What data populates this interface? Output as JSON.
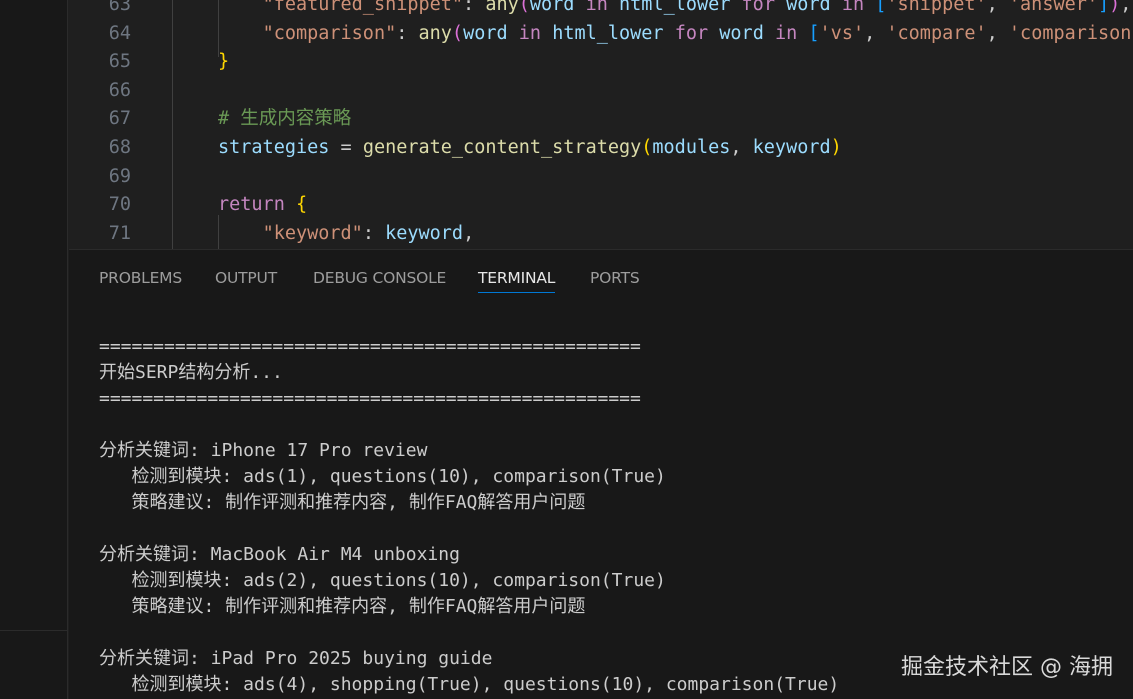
{
  "editor": {
    "lines": [
      {
        "num": "63",
        "parts": [
          {
            "t": "    ",
            "c": "pl"
          },
          {
            "t": "\"featured_snippet\"",
            "c": "str"
          },
          {
            "t": ": ",
            "c": "pl"
          },
          {
            "t": "any",
            "c": "fn"
          },
          {
            "t": "(",
            "c": "br2"
          },
          {
            "t": "word ",
            "c": "var"
          },
          {
            "t": "in ",
            "c": "kw"
          },
          {
            "t": "html_lower ",
            "c": "var"
          },
          {
            "t": "for ",
            "c": "kw"
          },
          {
            "t": "word ",
            "c": "var"
          },
          {
            "t": "in ",
            "c": "kw"
          },
          {
            "t": "[",
            "c": "br3"
          },
          {
            "t": "'snippet'",
            "c": "str"
          },
          {
            "t": ", ",
            "c": "pl"
          },
          {
            "t": "'answer'",
            "c": "str"
          },
          {
            "t": "]",
            "c": "br3"
          },
          {
            "t": ")",
            "c": "br2"
          },
          {
            "t": ",",
            "c": "pl"
          }
        ]
      },
      {
        "num": "64",
        "parts": [
          {
            "t": "    ",
            "c": "pl"
          },
          {
            "t": "\"comparison\"",
            "c": "str"
          },
          {
            "t": ": ",
            "c": "pl"
          },
          {
            "t": "any",
            "c": "fn"
          },
          {
            "t": "(",
            "c": "br2"
          },
          {
            "t": "word ",
            "c": "var"
          },
          {
            "t": "in ",
            "c": "kw"
          },
          {
            "t": "html_lower ",
            "c": "var"
          },
          {
            "t": "for ",
            "c": "kw"
          },
          {
            "t": "word ",
            "c": "var"
          },
          {
            "t": "in ",
            "c": "kw"
          },
          {
            "t": "[",
            "c": "br3"
          },
          {
            "t": "'vs'",
            "c": "str"
          },
          {
            "t": ", ",
            "c": "pl"
          },
          {
            "t": "'compare'",
            "c": "str"
          },
          {
            "t": ", ",
            "c": "pl"
          },
          {
            "t": "'comparison'",
            "c": "str"
          },
          {
            "t": "]",
            "c": "br3"
          },
          {
            "t": ")",
            "c": "br2"
          }
        ]
      },
      {
        "num": "65",
        "parts": [
          {
            "t": "}",
            "c": "br1"
          }
        ]
      },
      {
        "num": "66",
        "parts": []
      },
      {
        "num": "67",
        "parts": [
          {
            "t": "# 生成内容策略",
            "c": "cm"
          }
        ]
      },
      {
        "num": "68",
        "parts": [
          {
            "t": "strategies ",
            "c": "var"
          },
          {
            "t": "= ",
            "c": "pl"
          },
          {
            "t": "generate_content_strategy",
            "c": "fn"
          },
          {
            "t": "(",
            "c": "br1"
          },
          {
            "t": "modules",
            "c": "var"
          },
          {
            "t": ", ",
            "c": "pl"
          },
          {
            "t": "keyword",
            "c": "var"
          },
          {
            "t": ")",
            "c": "br1"
          }
        ]
      },
      {
        "num": "69",
        "parts": []
      },
      {
        "num": "70",
        "parts": [
          {
            "t": "return ",
            "c": "kw"
          },
          {
            "t": "{",
            "c": "br1"
          }
        ]
      },
      {
        "num": "71",
        "parts": [
          {
            "t": "    ",
            "c": "pl"
          },
          {
            "t": "\"keyword\"",
            "c": "str"
          },
          {
            "t": ": ",
            "c": "pl"
          },
          {
            "t": "keyword",
            "c": "var"
          },
          {
            "t": ",",
            "c": "pl"
          }
        ]
      }
    ]
  },
  "panel": {
    "tabs": [
      {
        "label": "PROBLEMS",
        "active": false
      },
      {
        "label": "OUTPUT",
        "active": false
      },
      {
        "label": "DEBUG CONSOLE",
        "active": false
      },
      {
        "label": "TERMINAL",
        "active": true
      },
      {
        "label": "PORTS",
        "active": false
      }
    ]
  },
  "terminal": {
    "lines": [
      "==================================================",
      "开始SERP结构分析...",
      "==================================================",
      "",
      "分析关键词: iPhone 17 Pro review",
      "   检测到模块: ads(1), questions(10), comparison(True)",
      "   策略建议: 制作评测和推荐内容, 制作FAQ解答用户问题",
      "",
      "分析关键词: MacBook Air M4 unboxing",
      "   检测到模块: ads(2), questions(10), comparison(True)",
      "   策略建议: 制作评测和推荐内容, 制作FAQ解答用户问题",
      "",
      "分析关键词: iPad Pro 2025 buying guide",
      "   检测到模块: ads(4), shopping(True), questions(10), comparison(True)"
    ]
  },
  "watermark": "掘金技术社区 @ 海拥",
  "colors": {
    "keyword": "#c586c0",
    "function": "#dcdcaa",
    "variable": "#9cdcfe",
    "string": "#ce9178",
    "comment": "#6a9955",
    "active_tab_underline": "#0078d4"
  }
}
